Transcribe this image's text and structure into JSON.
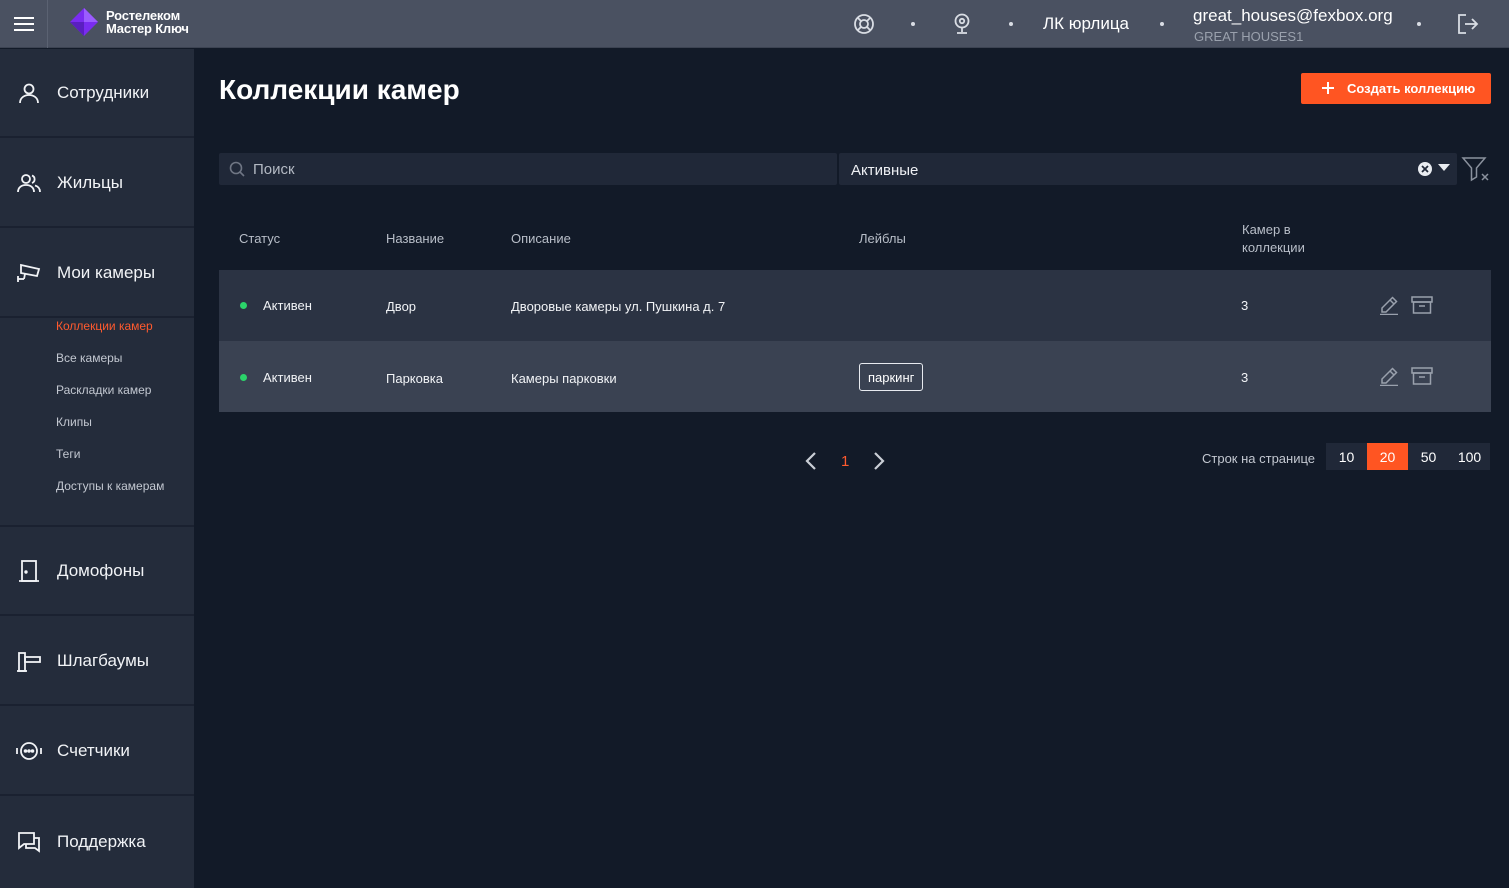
{
  "topbar": {
    "logo_line1": "Ростелеком",
    "logo_line2": "Мастер Ключ",
    "support_icon": "lifebuoy-icon",
    "camera_icon": "webcam-icon",
    "account_label": "ЛК юрлица",
    "user_email": "great_houses@fexbox.org",
    "user_org": "GREAT HOUSES1",
    "logout_icon": "logout-icon"
  },
  "sidebar": {
    "items": [
      {
        "label": "Сотрудники",
        "icon": "user-icon"
      },
      {
        "label": "Жильцы",
        "icon": "users-icon"
      },
      {
        "label": "Мои камеры",
        "icon": "security-camera-icon"
      },
      {
        "label": "Домофоны",
        "icon": "door-icon"
      },
      {
        "label": "Шлагбаумы",
        "icon": "barrier-icon"
      },
      {
        "label": "Счетчики",
        "icon": "meter-icon"
      },
      {
        "label": "Поддержка",
        "icon": "chat-icon"
      }
    ],
    "sub_items": [
      {
        "label": "Коллекции камер",
        "active": true
      },
      {
        "label": "Все камеры",
        "active": false
      },
      {
        "label": "Раскладки камер",
        "active": false
      },
      {
        "label": "Клипы",
        "active": false
      },
      {
        "label": "Теги",
        "active": false
      },
      {
        "label": "Доступы к камерам",
        "active": false
      }
    ]
  },
  "main": {
    "title": "Коллекции камер",
    "create_button": "Создать коллекцию",
    "search_placeholder": "Поиск",
    "status_filter": "Активные"
  },
  "table": {
    "headers": {
      "status": "Статус",
      "name": "Название",
      "description": "Описание",
      "labels": "Лейблы",
      "count_line1": "Камер в",
      "count_line2": "коллекции"
    },
    "rows": [
      {
        "status": "Активен",
        "name": "Двор",
        "description": "Дворовые камеры ул. Пушкина д. 7",
        "label": "",
        "count": "3"
      },
      {
        "status": "Активен",
        "name": "Парковка",
        "description": "Камеры парковки",
        "label": "паркинг",
        "count": "3"
      }
    ]
  },
  "pagination": {
    "current_page": "1",
    "rows_per_page_label": "Строк на странице",
    "options": [
      "10",
      "20",
      "50",
      "100"
    ],
    "selected": "20"
  },
  "colors": {
    "accent": "#ff5522",
    "status_active": "#2bd46a",
    "background": "#121a28",
    "sidebar": "#242c3b",
    "topbar": "#4a5161"
  }
}
